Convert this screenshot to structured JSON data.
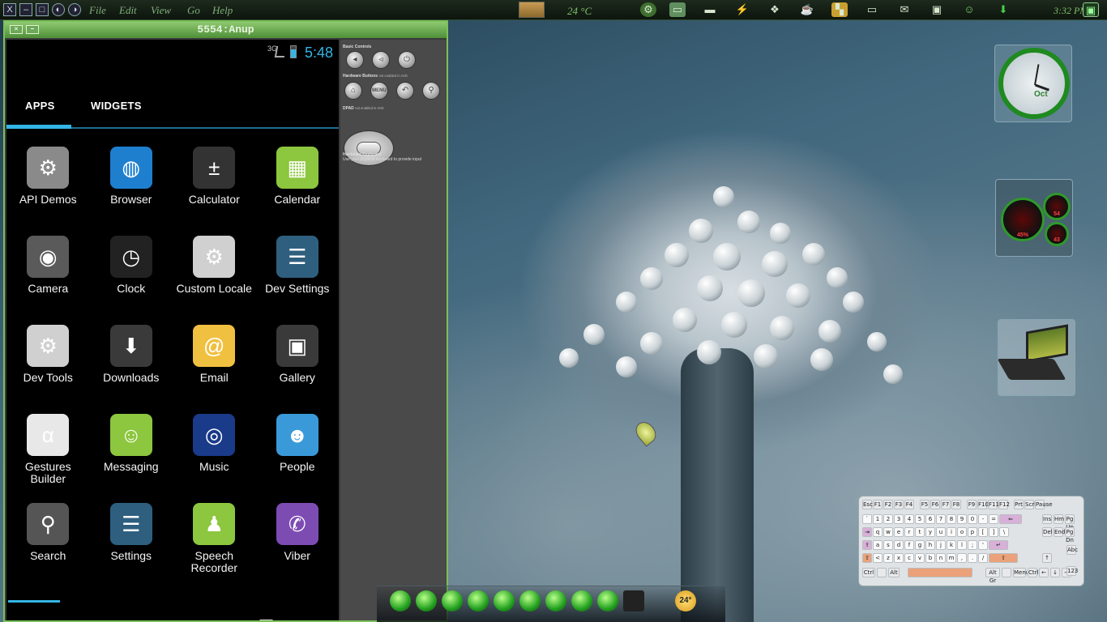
{
  "topbar": {
    "window_buttons": [
      "X",
      "–",
      "□"
    ],
    "menu": [
      "File",
      "Edit",
      "View",
      "Go",
      "Help"
    ],
    "temperature": "24 °C",
    "clock": "3:32 PM",
    "tray_icons": [
      "gear-icon",
      "folder-icon",
      "drive-icon",
      "power-icon",
      "dropbox-icon",
      "cup-icon",
      "palette-icon",
      "keyboard-icon",
      "mail-icon",
      "battery-icon",
      "user-icon",
      "download-icon",
      "window-icon"
    ]
  },
  "emulator": {
    "title": "5554:Anup",
    "status_bar": {
      "network": "3G",
      "time": "5:48"
    },
    "tabs": [
      "APPS",
      "WIDGETS"
    ],
    "apps": [
      {
        "label": "API Demos",
        "icon": "folder-gear-icon",
        "color": "#8a8a8a",
        "glyph": "⚙"
      },
      {
        "label": "Browser",
        "icon": "globe-icon",
        "color": "#1f7fcf",
        "glyph": "◍"
      },
      {
        "label": "Calculator",
        "icon": "calculator-icon",
        "color": "#333333",
        "glyph": "±"
      },
      {
        "label": "Calendar",
        "icon": "calendar-icon",
        "color": "#8dc63f",
        "glyph": "▦"
      },
      {
        "label": "Camera",
        "icon": "camera-icon",
        "color": "#5a5a5a",
        "glyph": "◉"
      },
      {
        "label": "Clock",
        "icon": "clock-icon",
        "color": "#222222",
        "glyph": "◷"
      },
      {
        "label": "Custom Locale",
        "icon": "gear-orange-icon",
        "color": "#d0d0d0",
        "glyph": "⚙"
      },
      {
        "label": "Dev Settings",
        "icon": "sliders-icon",
        "color": "#2f5f7f",
        "glyph": "☰"
      },
      {
        "label": "Dev Tools",
        "icon": "gear-orange-icon",
        "color": "#d0d0d0",
        "glyph": "⚙"
      },
      {
        "label": "Downloads",
        "icon": "download-icon",
        "color": "#3a3a3a",
        "glyph": "⬇"
      },
      {
        "label": "Email",
        "icon": "email-icon",
        "color": "#f0c040",
        "glyph": "@"
      },
      {
        "label": "Gallery",
        "icon": "gallery-icon",
        "color": "#3a3a3a",
        "glyph": "▣"
      },
      {
        "label": "Gestures Builder",
        "icon": "gesture-icon",
        "color": "#e8e8e8",
        "glyph": "α"
      },
      {
        "label": "Messaging",
        "icon": "message-icon",
        "color": "#8dc63f",
        "glyph": "☺"
      },
      {
        "label": "Music",
        "icon": "music-icon",
        "color": "#1a3a8a",
        "glyph": "◎"
      },
      {
        "label": "People",
        "icon": "people-icon",
        "color": "#3a9ad9",
        "glyph": "☻"
      },
      {
        "label": "Search",
        "icon": "magnifier-icon",
        "color": "#555555",
        "glyph": "⚲"
      },
      {
        "label": "Settings",
        "icon": "sliders-icon",
        "color": "#2f5f7f",
        "glyph": "☰"
      },
      {
        "label": "Speech Recorder",
        "icon": "android-icon",
        "color": "#8dc63f",
        "glyph": "♟"
      },
      {
        "label": "Viber",
        "icon": "viber-icon",
        "color": "#7d4cb3",
        "glyph": "✆"
      }
    ],
    "nav": [
      {
        "name": "back-icon",
        "glyph": "⟵"
      },
      {
        "name": "home-icon",
        "glyph": "⌂"
      },
      {
        "name": "recent-apps-icon",
        "glyph": "❐"
      }
    ],
    "controls": {
      "basic": "Basic Controls",
      "hardware_buttons": "Hardware Buttons",
      "hardware_note": "not enabled in AVD",
      "dpad": "DPAD",
      "dpad_note": "not enabled in AVD",
      "keyboard": "Hardware Keyboard",
      "keyboard_note": "Use your physical keyboard to provide input",
      "menu_label": "MENU"
    }
  },
  "widgets": {
    "clock_date": "Oct",
    "gauges": [
      "45%",
      "54",
      "43"
    ]
  },
  "keyboard": {
    "fn_row": [
      "Esc",
      "F1",
      "F2",
      "F3",
      "F4",
      "F5",
      "F6",
      "F7",
      "F8",
      "F9",
      "F10",
      "F11",
      "F12",
      "Prt",
      "Scrl",
      "Pause"
    ],
    "row1": [
      "`",
      "1",
      "2",
      "3",
      "4",
      "5",
      "6",
      "7",
      "8",
      "9",
      "0",
      "-",
      "=",
      "⇐"
    ],
    "row2": [
      "⇥",
      "q",
      "w",
      "e",
      "r",
      "t",
      "y",
      "u",
      "i",
      "o",
      "p",
      "[",
      "]",
      "\\"
    ],
    "row3": [
      "⇪",
      "a",
      "s",
      "d",
      "f",
      "g",
      "h",
      "j",
      "k",
      "l",
      ";",
      "'",
      "↵"
    ],
    "row4": [
      "⇧",
      "<",
      "z",
      "x",
      "c",
      "v",
      "b",
      "n",
      "m",
      ",",
      ".",
      "/",
      "⇧"
    ],
    "row5": [
      "Ctrl",
      "Alt",
      "Alt Gr",
      "Menu",
      "Ctrl"
    ],
    "nav_keys": [
      "Ins",
      "Hm",
      "Pg Up",
      "Del",
      "End",
      "Pg Dn",
      "↑",
      "←",
      "↓",
      "→",
      "Abc",
      "123"
    ]
  },
  "dock": {
    "icons": [
      "green-orb-icon",
      "ubuntu-icon",
      "bird-icon",
      "book-icon",
      "chrome-icon",
      "green-face-icon",
      "globe-icon",
      "skype-icon",
      "ubuntu-square-icon",
      "terminal-icon",
      "bars-icon",
      "weather-icon"
    ],
    "weather_temp": "24°"
  }
}
